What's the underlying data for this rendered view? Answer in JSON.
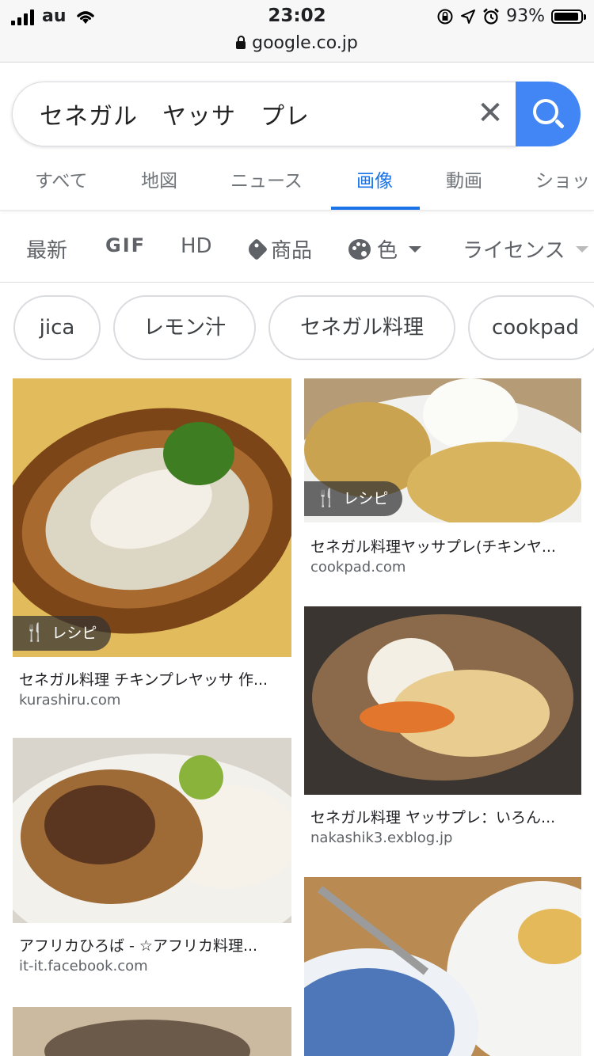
{
  "status_bar": {
    "carrier": "au",
    "time": "23:02",
    "battery": "93%",
    "battery_level": 0.93,
    "url": "google.co.jp"
  },
  "search": {
    "query": "セネガル　ヤッサ　プレ",
    "clear_icon": "✕"
  },
  "tabs": [
    {
      "label": "すべて"
    },
    {
      "label": "地図"
    },
    {
      "label": "ニュース"
    },
    {
      "label": "画像",
      "active": true
    },
    {
      "label": "動画"
    },
    {
      "label": "ショッ"
    }
  ],
  "filters": {
    "latest": "最新",
    "gif": "GIF",
    "hd": "HD",
    "products": "商品",
    "color": "色",
    "license": "ライセンス"
  },
  "chips": [
    "jica",
    "レモン汁",
    "セネガル料理",
    "cookpad"
  ],
  "results": [
    {
      "title": "セネガル料理 チキンプレヤッサ 作...",
      "source": "kurashiru.com",
      "badge": "レシピ"
    },
    {
      "title": "セネガル料理ヤッサプレ(チキンヤ...",
      "source": "cookpad.com",
      "badge": "レシピ"
    },
    {
      "title": "アフリカひろば - ☆アフリカ料理...",
      "source": "it-it.facebook.com"
    },
    {
      "title": "セネガル料理 ヤッサプレ：いろん...",
      "source": "nakashik3.exblog.jp"
    }
  ],
  "colors": {
    "accent": "#1a73e8",
    "search_button": "#4285f4"
  }
}
